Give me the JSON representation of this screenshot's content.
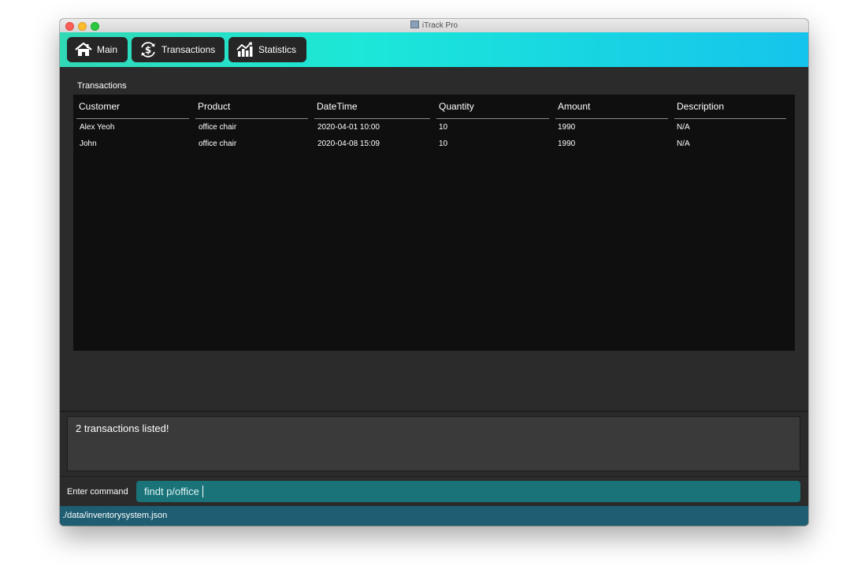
{
  "window": {
    "title": "iTrack Pro"
  },
  "toolbar": {
    "tabs": [
      {
        "label": "Main",
        "icon": "home-icon"
      },
      {
        "label": "Transactions",
        "icon": "dollar-cycle-icon"
      },
      {
        "label": "Statistics",
        "icon": "bar-chart-icon"
      }
    ]
  },
  "transactions": {
    "section_label": "Transactions",
    "columns": [
      "Customer",
      "Product",
      "DateTime",
      "Quantity",
      "Amount",
      "Description"
    ],
    "rows": [
      [
        "Alex Yeoh",
        "office chair",
        "2020-04-01 10:00",
        "10",
        "1990",
        "N/A"
      ],
      [
        "John",
        "office chair",
        "2020-04-08 15:09",
        "10",
        "1990",
        "N/A"
      ]
    ]
  },
  "result": {
    "text": "2 transactions listed!"
  },
  "command": {
    "label": "Enter command",
    "value": "findt p/office"
  },
  "status": {
    "path": "./data/inventorysystem.json"
  },
  "colors": {
    "toolbar_gradient_start": "#31d9b5",
    "toolbar_gradient_end": "#15c4ec",
    "command_input_bg": "#1a7379",
    "status_bar_bg": "#1f5d72",
    "table_bg": "#0f0f0f",
    "panel_bg": "#2b2b2b"
  }
}
